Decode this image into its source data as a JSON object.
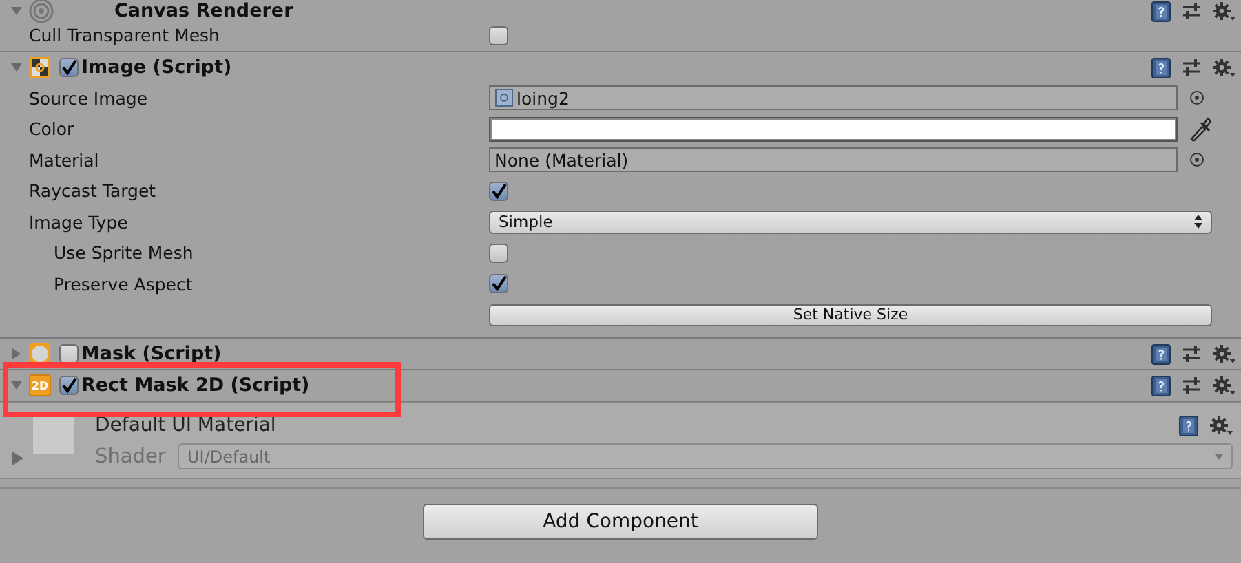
{
  "components": [
    {
      "title": "Canvas Renderer",
      "kind": "renderer",
      "expanded": true,
      "properties": [
        {
          "kind": "checkbox",
          "label": "Cull Transparent Mesh",
          "checked": false
        }
      ]
    },
    {
      "title": "Image (Script)",
      "kind": "image",
      "enabled": true,
      "expanded": true,
      "properties": [
        {
          "kind": "sprite",
          "label": "Source Image",
          "value": "loing2"
        },
        {
          "kind": "color",
          "label": "Color",
          "color": "#ffffff"
        },
        {
          "kind": "object",
          "label": "Material",
          "value": "None (Material)"
        },
        {
          "kind": "checkbox",
          "label": "Raycast Target",
          "checked": true
        },
        {
          "kind": "dropdown",
          "label": "Image Type",
          "value": "Simple",
          "children": [
            {
              "kind": "checkbox",
              "label": "Use Sprite Mesh",
              "checked": false
            },
            {
              "kind": "checkbox",
              "label": "Preserve Aspect",
              "checked": true
            }
          ]
        },
        {
          "kind": "button",
          "label": "Set Native Size"
        }
      ]
    },
    {
      "title": "Mask (Script)",
      "kind": "mask",
      "enabled": false,
      "expanded": false
    },
    {
      "title": "Rect Mask 2D (Script)",
      "kind": "rectmask",
      "icon_text": "2D",
      "enabled": true,
      "expanded": true,
      "highlighted": true
    }
  ],
  "material": {
    "title": "Default UI Material",
    "expanded": false,
    "shader_label": "Shader",
    "shader": "UI/Default",
    "shader_disabled": true
  },
  "add_button": "Add Component"
}
